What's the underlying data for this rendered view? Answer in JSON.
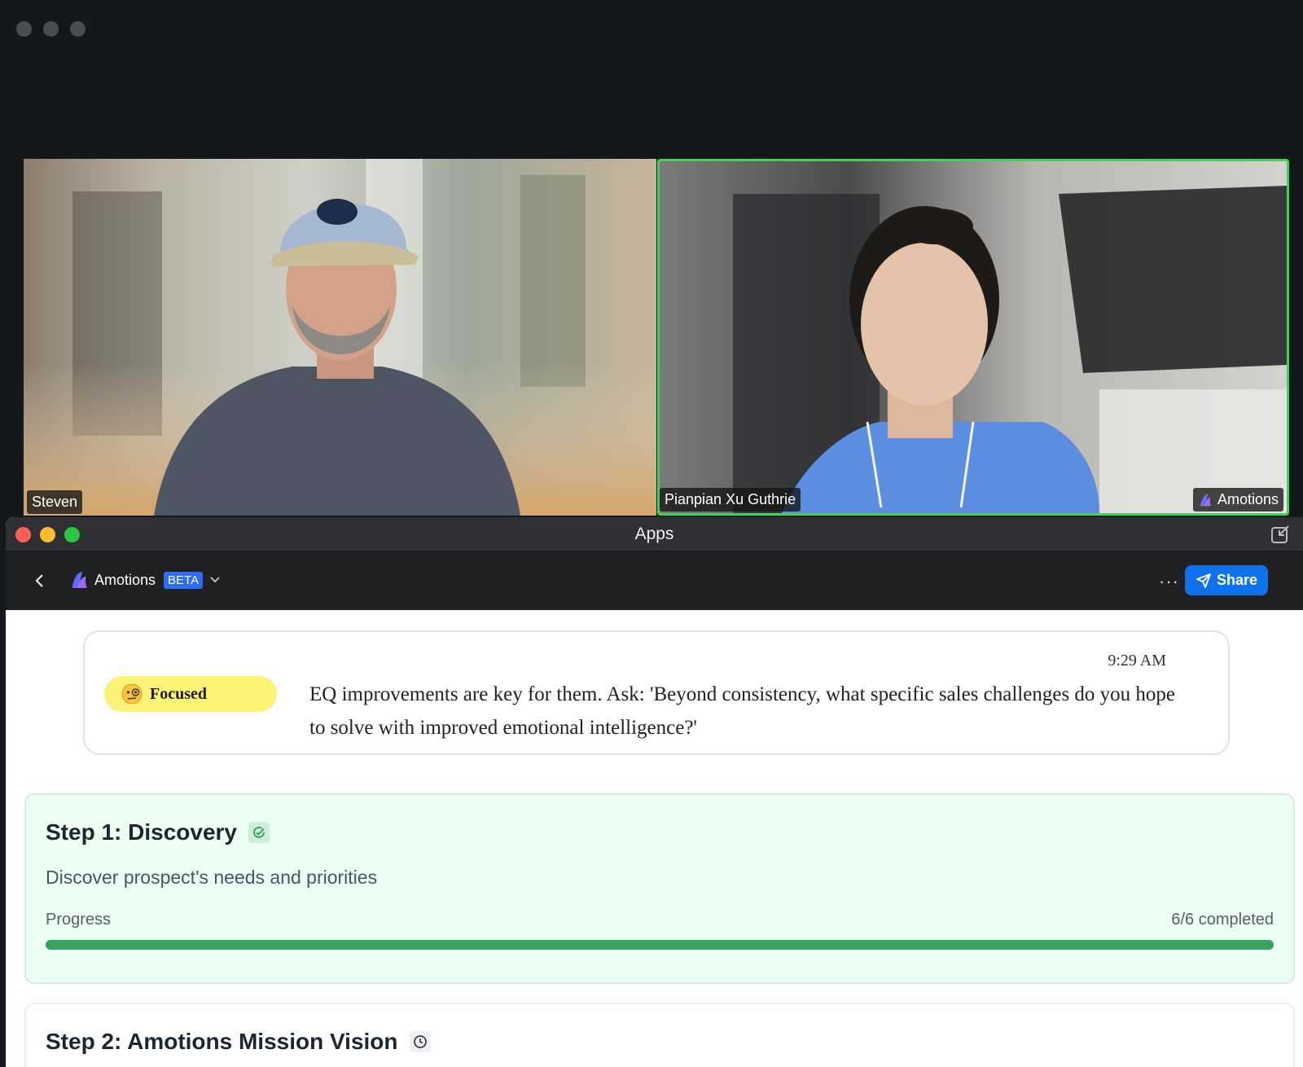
{
  "video_tiles": [
    {
      "name": "Steven"
    },
    {
      "name": "Pianpian Xu Guthrie",
      "app_badge": "Amotions"
    }
  ],
  "apps_window": {
    "title": "Apps",
    "app_name": "Amotions",
    "badge": "BETA",
    "share_label": "Share"
  },
  "insight": {
    "time": "9:29 AM",
    "mood": "Focused",
    "text": "EQ improvements are key for them. Ask: 'Beyond consistency, what specific sales challenges do you hope to solve with improved emotional intelligence?'"
  },
  "steps": [
    {
      "title": "Step 1: Discovery",
      "description": "Discover prospect's needs and priorities",
      "progress_label": "Progress",
      "progress_text": "6/6 completed",
      "progress_fraction": 1.0,
      "status": "completed"
    },
    {
      "title": "Step 2: Amotions Mission Vision",
      "status": "pending"
    }
  ],
  "colors": {
    "accent_green": "#3fd256",
    "share_blue": "#0e72ed",
    "progress_green": "#38a261",
    "mood_yellow": "#fbf277"
  }
}
